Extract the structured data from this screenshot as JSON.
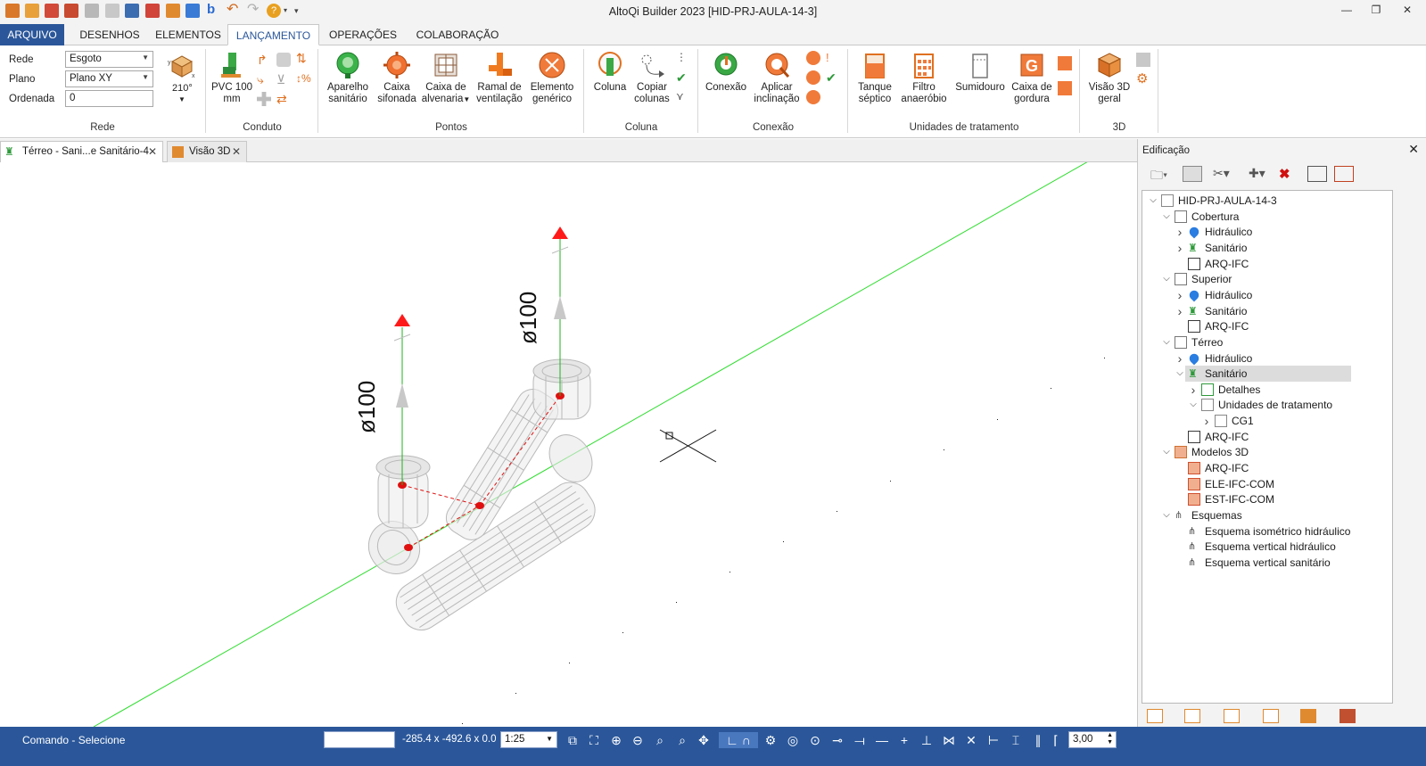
{
  "window": {
    "title": "AltoQi Builder 2023 [HID-PRJ-AULA-14-3]"
  },
  "ribbon_tabs": [
    "ARQUIVO",
    "DESENHOS",
    "ELEMENTOS",
    "LANÇAMENTO",
    "OPERAÇÕES",
    "COLABORAÇÃO"
  ],
  "rede_group": {
    "rede_label": "Rede",
    "rede_value": "Esgoto",
    "plano_label": "Plano",
    "plano_value": "Plano XY",
    "ordenada_label": "Ordenada",
    "ordenada_value": "0",
    "angle": "210°",
    "group_label": "Rede"
  },
  "groups": {
    "conduto": "Conduto",
    "pontos": "Pontos",
    "coluna": "Coluna",
    "conexao": "Conexão",
    "unidades": "Unidades de tratamento",
    "g3d": "3D"
  },
  "buttons": {
    "pvc_l1": "PVC 100",
    "pvc_l2": "mm",
    "aparelho_l1": "Aparelho",
    "aparelho_l2": "sanitário",
    "caixa_sif_l1": "Caixa",
    "caixa_sif_l2": "sifonada",
    "caixa_alv_l1": "Caixa de",
    "caixa_alv_l2": "alvenaria",
    "ramal_l1": "Ramal de",
    "ramal_l2": "ventilação",
    "elemento_l1": "Elemento",
    "elemento_l2": "genérico",
    "coluna": "Coluna",
    "copiar_l1": "Copiar",
    "copiar_l2": "colunas",
    "conexao": "Conexão",
    "aplicar_l1": "Aplicar",
    "aplicar_l2": "inclinação",
    "tanque_l1": "Tanque",
    "tanque_l2": "séptico",
    "filtro_l1": "Filtro",
    "filtro_l2": "anaeróbio",
    "sumidouro": "Sumidouro",
    "caixa_gord_l1": "Caixa de",
    "caixa_gord_l2": "gordura",
    "visao_l1": "Visão 3D",
    "visao_l2": "geral"
  },
  "doc_tabs": [
    "Térreo - Sani...e Sanitário-4",
    "Visão 3D"
  ],
  "viewport": {
    "dim_label_1": "ø100",
    "dim_label_2": "ø100"
  },
  "panel": {
    "title": "Edificação",
    "tree": [
      {
        "label": "HID-PRJ-AULA-14-3",
        "level": 0,
        "expander": "open",
        "icon": "project-icon"
      },
      {
        "label": "Cobertura",
        "level": 1,
        "expander": "open",
        "icon": "floor-icon"
      },
      {
        "label": "Hidráulico",
        "level": 2,
        "expander": "closed",
        "icon": "water-drop-icon"
      },
      {
        "label": "Sanitário",
        "level": 2,
        "expander": "closed",
        "icon": "toilet-icon"
      },
      {
        "label": "ARQ-IFC",
        "level": 2,
        "expander": "none",
        "icon": "ifc-icon"
      },
      {
        "label": "Superior",
        "level": 1,
        "expander": "open",
        "icon": "floor-icon"
      },
      {
        "label": "Hidráulico",
        "level": 2,
        "expander": "closed",
        "icon": "water-drop-icon"
      },
      {
        "label": "Sanitário",
        "level": 2,
        "expander": "closed",
        "icon": "toilet-icon"
      },
      {
        "label": "ARQ-IFC",
        "level": 2,
        "expander": "none",
        "icon": "ifc-icon"
      },
      {
        "label": "Térreo",
        "level": 1,
        "expander": "open",
        "icon": "floor-icon"
      },
      {
        "label": "Hidráulico",
        "level": 2,
        "expander": "closed",
        "icon": "water-drop-icon"
      },
      {
        "label": "Sanitário",
        "level": 2,
        "expander": "open",
        "icon": "toilet-icon",
        "selected": true
      },
      {
        "label": "Detalhes",
        "level": 3,
        "expander": "closed",
        "icon": "details-icon"
      },
      {
        "label": "Unidades de tratamento",
        "level": 3,
        "expander": "open",
        "icon": "tank-icon"
      },
      {
        "label": "CG1",
        "level": 4,
        "expander": "closed",
        "icon": "tank-icon"
      },
      {
        "label": "ARQ-IFC",
        "level": 2,
        "expander": "none",
        "icon": "ifc-icon"
      },
      {
        "label": "Modelos 3D",
        "level": 1,
        "expander": "open",
        "icon": "models-icon"
      },
      {
        "label": "ARQ-IFC",
        "level": 2,
        "expander": "none",
        "icon": "model-file-icon"
      },
      {
        "label": "ELE-IFC-COM",
        "level": 2,
        "expander": "none",
        "icon": "model-file-icon"
      },
      {
        "label": "EST-IFC-COM",
        "level": 2,
        "expander": "none",
        "icon": "model-file-icon"
      },
      {
        "label": "Esquemas",
        "level": 1,
        "expander": "open",
        "icon": "scheme-folder-icon"
      },
      {
        "label": "Esquema isométrico hidráulico",
        "level": 2,
        "expander": "none",
        "icon": "scheme-icon"
      },
      {
        "label": "Esquema vertical hidráulico",
        "level": 2,
        "expander": "none",
        "icon": "scheme-icon"
      },
      {
        "label": "Esquema vertical sanitário",
        "level": 2,
        "expander": "none",
        "icon": "scheme-icon"
      }
    ]
  },
  "status": {
    "command": "Comando - Selecione",
    "coords": "-285.4 x -492.6 x 0.0",
    "scale": "1:25",
    "value": "3,00"
  }
}
